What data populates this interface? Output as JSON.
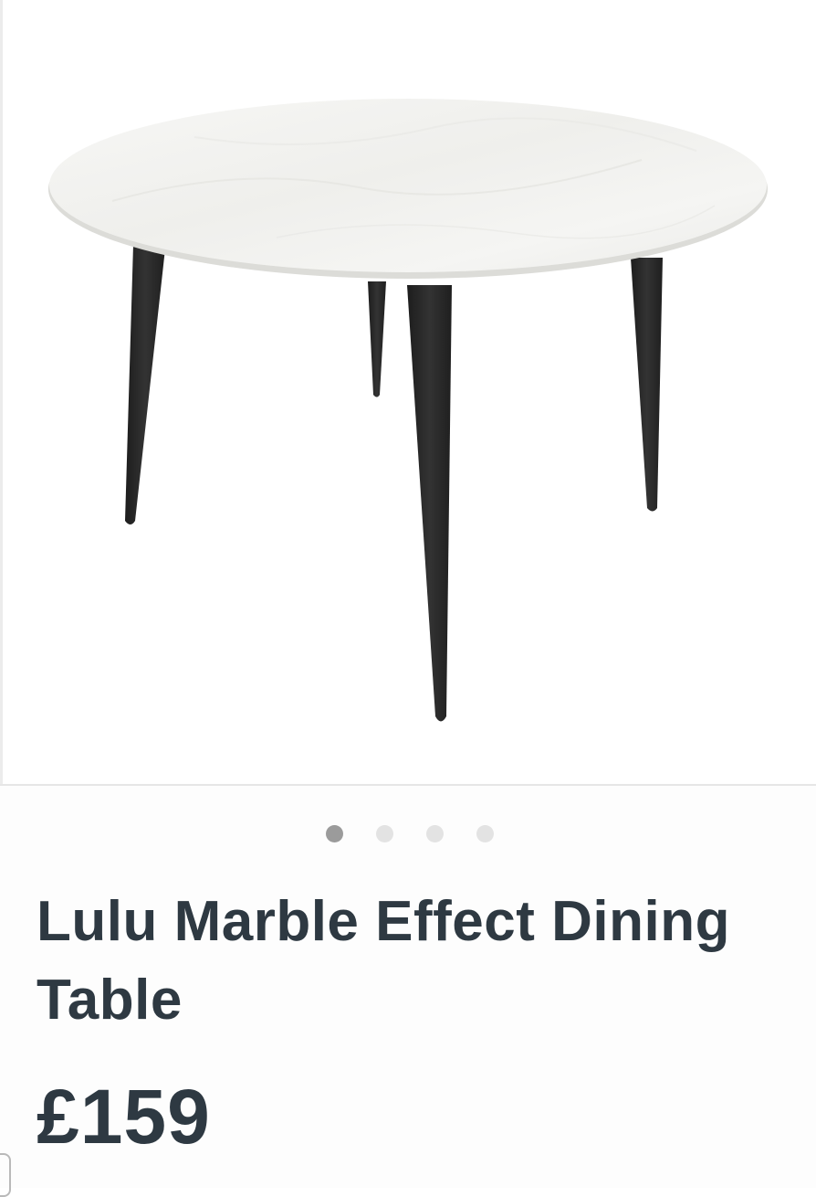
{
  "product": {
    "image_alt": "Lulu Marble Effect Dining Table",
    "title": "Lulu Marble Effect Dining Table",
    "price": "£159"
  },
  "carousel": {
    "dot_count": 4,
    "active_index": 0
  },
  "colors": {
    "title_text": "#2e3942",
    "dot_active": "#9b9b9b",
    "dot_inactive": "#e3e3e3",
    "table_top": "#f4f4f2",
    "table_legs": "#262626"
  }
}
